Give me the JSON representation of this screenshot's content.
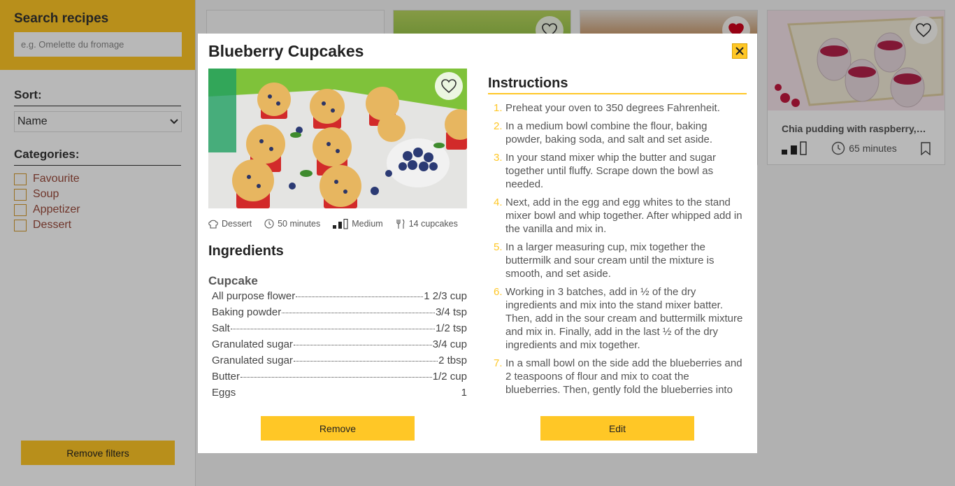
{
  "sidebar": {
    "search_title": "Search recipes",
    "search_placeholder": "e.g. Omelette du fromage",
    "sort_title": "Sort:",
    "sort_value": "Name",
    "categories_title": "Categories:",
    "categories": [
      "Favourite",
      "Soup",
      "Appetizer",
      "Dessert"
    ],
    "remove_filters": "Remove filters"
  },
  "cards": [
    {
      "title": "",
      "favourite": false
    },
    {
      "title": "",
      "favourite": false
    },
    {
      "title": "",
      "favourite": true
    },
    {
      "title": "Chia pudding with raspberry,blu...",
      "time": "65 minutes",
      "favourite": false
    }
  ],
  "modal": {
    "title": "Blueberry Cupcakes",
    "meta": {
      "category": "Dessert",
      "time": "50 minutes",
      "difficulty": "Medium",
      "servings": "14 cupcakes"
    },
    "ingredients_title": "Ingredients",
    "ingredient_group": "Cupcake",
    "ingredients": [
      {
        "name": "All purpose flower",
        "qty": "1 2/3 cup"
      },
      {
        "name": "Baking powder",
        "qty": "3/4 tsp"
      },
      {
        "name": "Salt",
        "qty": "1/2 tsp"
      },
      {
        "name": "Granulated sugar",
        "qty": "3/4 cup"
      },
      {
        "name": "Granulated sugar",
        "qty": "2 tbsp"
      },
      {
        "name": "Butter",
        "qty": "1/2 cup"
      },
      {
        "name": "Eggs",
        "qty": "1"
      }
    ],
    "instructions_title": "Instructions",
    "instructions": [
      "Preheat your oven to 350 degrees Fahrenheit.",
      "In a medium bowl combine the flour, baking powder, baking soda, and salt and set aside.",
      "In your stand mixer whip the butter and sugar together until fluffy. Scrape down the bowl as needed.",
      "Next, add in the egg and egg whites to the stand mixer bowl and whip together. After whipped add in the vanilla and mix in.",
      "In a larger measuring cup, mix together the buttermilk and sour cream until the mixture is smooth, and set aside.",
      "Working in 3 batches, add in ½ of the dry ingredients and mix into the stand mixer batter. Then, add in the sour cream and buttermilk mixture and mix in. Finally, add in the last ½ of the dry ingredients and mix together.",
      "In a small bowl on the side add the blueberries and 2 teaspoons of flour and mix to coat the blueberries. Then, gently fold the blueberries into"
    ],
    "remove_label": "Remove",
    "edit_label": "Edit"
  },
  "colors": {
    "accent": "#ffc726",
    "heart_active": "#d0021b"
  }
}
